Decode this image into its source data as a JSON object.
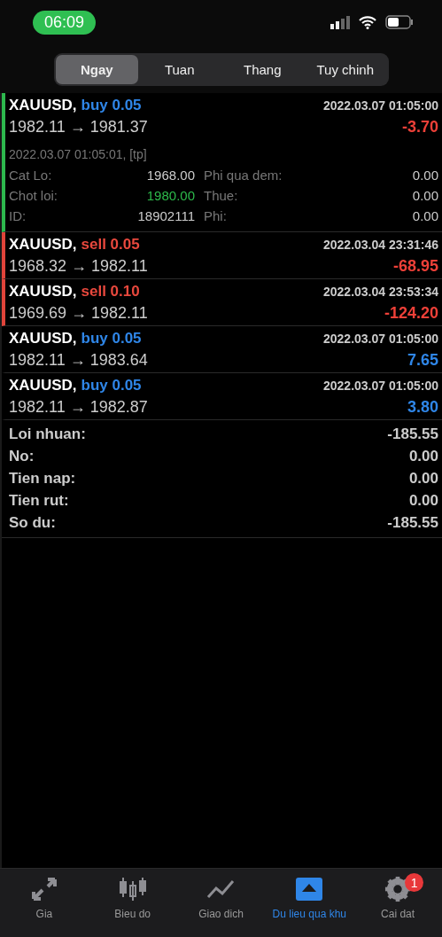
{
  "status_bar": {
    "time": "06:09"
  },
  "tabs": [
    {
      "label": "Ngay",
      "selected": true
    },
    {
      "label": "Tuan",
      "selected": false
    },
    {
      "label": "Thang",
      "selected": false
    },
    {
      "label": "Tuy chinh",
      "selected": false
    }
  ],
  "trades": [
    {
      "symbol": "XAUUSD,",
      "side": "buy",
      "volume": "0.05",
      "time": "2022.03.07 01:05:00",
      "prices": "1982.11 → 1981.37",
      "profit": "-3.70",
      "color": "#2db84d",
      "expanded": true,
      "close_info": "2022.03.07 01:05:01, [tp]",
      "details": [
        {
          "label": "Cat Lo:",
          "value": "1968.00",
          "label2": "Phi qua dem:",
          "value2": "0.00",
          "highlight": false
        },
        {
          "label": "Chot loi:",
          "value": "1980.00",
          "label2": "Thue:",
          "value2": "0.00",
          "highlight": true
        },
        {
          "label": "ID:",
          "value": "18902111",
          "label2": "Phi:",
          "value2": "0.00",
          "highlight": false
        }
      ]
    },
    {
      "symbol": "XAUUSD,",
      "side": "sell",
      "volume": "0.05",
      "time": "2022.03.04 23:31:46",
      "prices": "1968.32 → 1982.11",
      "profit": "-68.95",
      "color": "#e0443a",
      "expanded": false
    },
    {
      "symbol": "XAUUSD,",
      "side": "sell",
      "volume": "0.10",
      "time": "2022.03.04 23:53:34",
      "prices": "1969.69 → 1982.11",
      "profit": "-124.20",
      "color": "#e0443a",
      "expanded": false
    },
    {
      "symbol": "XAUUSD,",
      "side": "buy",
      "volume": "0.05",
      "time": "2022.03.07 01:05:00",
      "prices": "1982.11 → 1983.64",
      "profit": "7.65",
      "expanded": false
    },
    {
      "symbol": "XAUUSD,",
      "side": "buy",
      "volume": "0.05",
      "time": "2022.03.07 01:05:00",
      "prices": "1982.11 → 1982.87",
      "profit": "3.80",
      "expanded": false
    }
  ],
  "summary": [
    {
      "label": "Loi nhuan:",
      "value": "-185.55"
    },
    {
      "label": "No:",
      "value": "0.00"
    },
    {
      "label": "Tien nap:",
      "value": "0.00"
    },
    {
      "label": "Tien rut:",
      "value": "0.00"
    },
    {
      "label": "So du:",
      "value": "-185.55"
    }
  ],
  "tab_bar": [
    {
      "label": "Gia",
      "kind": "quotes",
      "selected": false
    },
    {
      "label": "Bieu do",
      "kind": "chart",
      "selected": false
    },
    {
      "label": "Giao dich",
      "kind": "trade",
      "selected": false
    },
    {
      "label": "Du lieu qua khu",
      "kind": "history",
      "selected": true
    },
    {
      "label": "Cai dat",
      "kind": "settings",
      "selected": false,
      "badge": "1"
    }
  ]
}
